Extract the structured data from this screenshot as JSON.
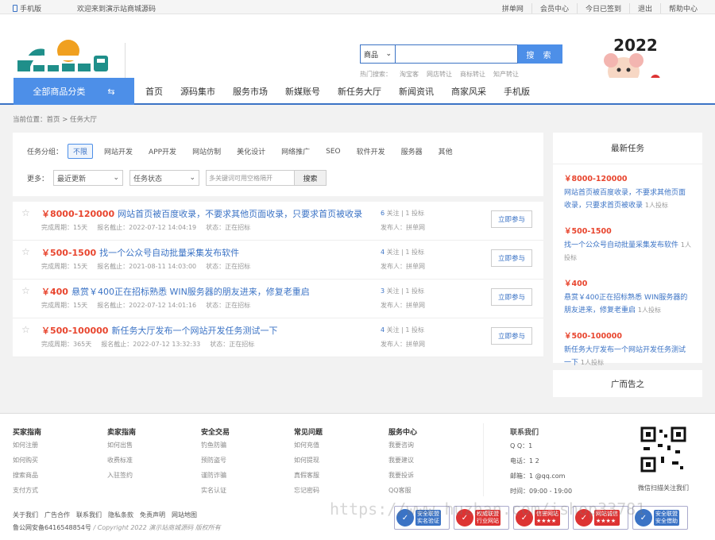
{
  "topbar": {
    "mobile": "手机版",
    "welcome": "欢迎来到演示站商城源码",
    "links": [
      "拼单网",
      "会员中心",
      "今日已签到",
      "退出",
      "帮助中心"
    ]
  },
  "search": {
    "select": "商品",
    "placeholder": "",
    "button": "搜 索",
    "hot_label": "热门搜索：",
    "hot": [
      "淘宝客",
      "网店转让",
      "商标转让",
      "知产转让"
    ]
  },
  "badge_text": "2022",
  "nav": {
    "all": "全部商品分类",
    "items": [
      "首页",
      "源码集市",
      "服务市场",
      "新媒账号",
      "新任务大厅",
      "新闻资讯",
      "商家风采",
      "手机版"
    ]
  },
  "breadcrumb": "当前位置：首页 > 任务大厅",
  "filter": {
    "cat_label": "任务分组：",
    "cats": [
      "不限",
      "网站开发",
      "APP开发",
      "网站仿制",
      "美化设计",
      "网络推广",
      "SEO",
      "软件开发",
      "服务器",
      "其他"
    ],
    "more_label": "更多：",
    "sort": "最近更新",
    "status": "任务状态",
    "kw_placeholder": "多关键词可用空格隔开",
    "search_btn": "搜索"
  },
  "tasks": [
    {
      "price": "￥8000-120000",
      "title": "网站首页被百度收录，不要求其他页面收录，只要求首页被收录",
      "period": "完成周期：15天",
      "deadline": "报名截止：2022-07-12 14:04:19",
      "status": "状态：正在招标",
      "follow": "6",
      "bid": "1",
      "stat_text": " 关注 | 1 投标",
      "publisher": "发布人：拼单网",
      "join": "立即参与"
    },
    {
      "price": "￥500-1500",
      "title": "找一个公众号自动批量采集发布软件",
      "period": "完成周期：15天",
      "deadline": "报名截止：2021-08-11 14:03:00",
      "status": "状态：正在招标",
      "follow": "4",
      "stat_text": " 关注 | 1 投标",
      "publisher": "发布人：拼单网",
      "join": "立即参与"
    },
    {
      "price": "￥400",
      "title": "悬赏￥400正在招标熟悉 WIN服务器的朋友进来，修复老重启",
      "period": "完成周期：15天",
      "deadline": "报名截止：2022-07-12 14:01:16",
      "status": "状态：正在招标",
      "follow": "3",
      "stat_text": " 关注 | 1 投标",
      "publisher": "发布人：拼单网",
      "join": "立即参与"
    },
    {
      "price": "￥500-100000",
      "title": "新任务大厅发布一个网站开发任务测试一下",
      "period": "完成周期：365天",
      "deadline": "报名截止：2022-07-12 13:32:33",
      "status": "状态：正在招标",
      "follow": "4",
      "stat_text": " 关注 | 1 投标",
      "publisher": "发布人：拼单网",
      "join": "立即参与"
    }
  ],
  "side": {
    "title": "最新任务",
    "items": [
      {
        "price": "￥8000-120000",
        "title": "网站首页被百度收录，不要求其他页面收录，只要求首页被收录",
        "bid": "1人投标"
      },
      {
        "price": "￥500-1500",
        "title": "找一个公众号自动批量采集发布软件",
        "bid": "1人投标"
      },
      {
        "price": "￥400",
        "title": "悬赏￥400正在招标熟悉 WIN服务器的朋友进来，修复老重启",
        "bid": "1人投标"
      },
      {
        "price": "￥500-100000",
        "title": "新任务大厅发布一个网站开发任务测试一下",
        "bid": "1人投标"
      }
    ],
    "ad": "广而告之"
  },
  "footer": {
    "cols": [
      {
        "title": "买家指南",
        "items": [
          "如何注册",
          "如何购买",
          "搜索商品",
          "支付方式"
        ]
      },
      {
        "title": "卖家指南",
        "items": [
          "如何出售",
          "收费标准",
          "入驻签约"
        ]
      },
      {
        "title": "安全交易",
        "items": [
          "钓鱼防骗",
          "预防盗号",
          "谨防诈骗",
          "实名认证"
        ]
      },
      {
        "title": "常见问题",
        "items": [
          "如何充值",
          "如何提现",
          "真假客服",
          "忘记密码"
        ]
      },
      {
        "title": "服务中心",
        "items": [
          "我要咨询",
          "我要建议",
          "我要投诉",
          "QQ客服"
        ]
      }
    ],
    "contact": {
      "title": "联系我们",
      "qq": "Q Q：1",
      "phone": "电话：1                2",
      "email": "邮箱：1                 @qq.com",
      "hours": "时间：09:00 - 19:00"
    },
    "qr_caption": "微信扫描关注我们",
    "links": [
      "关于我们",
      "广告合作",
      "联系我们",
      "隐私条款",
      "免责声明",
      "网站地图"
    ],
    "icp": "鲁公网安备6416548854号",
    "copyright": "/ Copyright 2022 演示站商城源码 版权所有",
    "certs": [
      {
        "label": "安全联盟\n实名验证",
        "color": "#3b73c5"
      },
      {
        "label": "权威联盟\n行业网站",
        "color": "#d33"
      },
      {
        "label": "信誉网站\n★★★★",
        "color": "#d33"
      },
      {
        "label": "网站诚信\n★★★★",
        "color": "#d33"
      },
      {
        "label": "安全联盟\n安全借助",
        "color": "#3b73c5"
      }
    ]
  },
  "watermark": "https://www.huzhan.com/ishop33781"
}
